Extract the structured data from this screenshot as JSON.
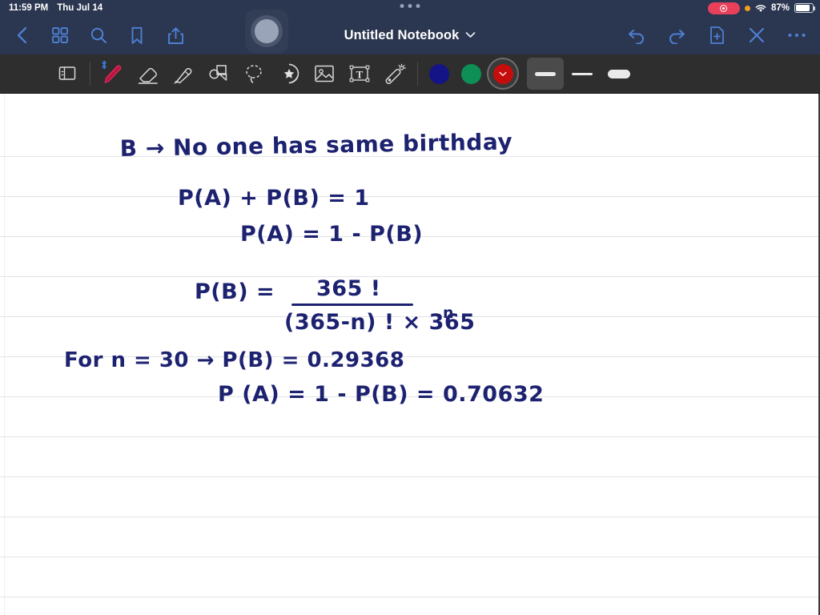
{
  "status_bar": {
    "time": "11:59 PM",
    "date": "Thu Jul 14",
    "battery_percent": "87%",
    "icons": [
      "screen-record-pill",
      "orange-privacy-dot",
      "wifi-icon",
      "battery-icon"
    ]
  },
  "nav_bar": {
    "title": "Untitled Notebook",
    "title_chevron": "chevron-down-icon",
    "left_icons": [
      {
        "name": "back-chevron-icon",
        "label": "Back"
      },
      {
        "name": "grid-view-icon",
        "label": "Page Grid"
      },
      {
        "name": "search-icon",
        "label": "Search"
      },
      {
        "name": "bookmark-icon",
        "label": "Bookmark"
      },
      {
        "name": "share-icon",
        "label": "Share"
      }
    ],
    "right_icons": [
      {
        "name": "undo-icon",
        "label": "Undo"
      },
      {
        "name": "redo-icon",
        "label": "Redo"
      },
      {
        "name": "new-page-icon",
        "label": "New Page"
      },
      {
        "name": "close-icon",
        "label": "Close"
      },
      {
        "name": "more-options-icon",
        "label": "More"
      }
    ],
    "assistive_touch": "assistive-touch-button",
    "multitask_handle": "multitask-dots"
  },
  "toolbar": {
    "tools": [
      {
        "name": "page-layers-icon",
        "label": "Page Layers",
        "selected": false
      },
      {
        "name": "pen-icon",
        "label": "Pen",
        "selected": true,
        "badge": "bluetooth-icon"
      },
      {
        "name": "eraser-icon",
        "label": "Eraser",
        "selected": false
      },
      {
        "name": "highlighter-icon",
        "label": "Highlighter",
        "selected": false
      },
      {
        "name": "shapes-icon",
        "label": "Shapes",
        "selected": false
      },
      {
        "name": "lasso-icon",
        "label": "Lasso Select",
        "selected": false
      },
      {
        "name": "sticker-icon",
        "label": "Sticker",
        "selected": false
      },
      {
        "name": "image-icon",
        "label": "Insert Image",
        "selected": false
      },
      {
        "name": "text-box-icon",
        "label": "Text Box",
        "selected": false
      },
      {
        "name": "laser-pointer-icon",
        "label": "Laser Pointer",
        "selected": false
      }
    ],
    "colors": [
      {
        "name": "color-swatch-navy",
        "hex": "#141486",
        "active": false
      },
      {
        "name": "color-swatch-green",
        "hex": "#0d8f55",
        "active": false
      },
      {
        "name": "color-swatch-red",
        "hex": "#c60d0d",
        "active": true,
        "chevron": "chevron-down-icon"
      }
    ],
    "stroke_widths": [
      {
        "name": "stroke-width-thick",
        "selected": true
      },
      {
        "name": "stroke-width-thin",
        "selected": false
      },
      {
        "name": "stroke-width-extra-thick",
        "selected": false
      }
    ]
  },
  "notes": {
    "paper_style": "ruled-lines",
    "ink_color": "#1d2270",
    "lines": [
      {
        "id": "line-definition-b",
        "text": "B →   No one  has  same  birthday"
      },
      {
        "id": "line-sum-probabilities",
        "text": "P(A) +  P(B)  =  1"
      },
      {
        "id": "line-pa-equals",
        "text": "P(A)    =    1 -  P(B)"
      },
      {
        "id": "line-pb-label",
        "text": "P(B)   ="
      },
      {
        "id": "line-fraction-numerator",
        "text": "365 !"
      },
      {
        "id": "line-fraction-denominator",
        "text": "(365-n) !  ×  365"
      },
      {
        "id": "line-fraction-exponent",
        "text": "n"
      },
      {
        "id": "line-for-n-30",
        "text": "For  n = 30  →   P(B)  =   0.29368"
      },
      {
        "id": "line-pa-result",
        "text": "P (A)   =   1 -  P(B)   =   0.70632"
      }
    ]
  }
}
